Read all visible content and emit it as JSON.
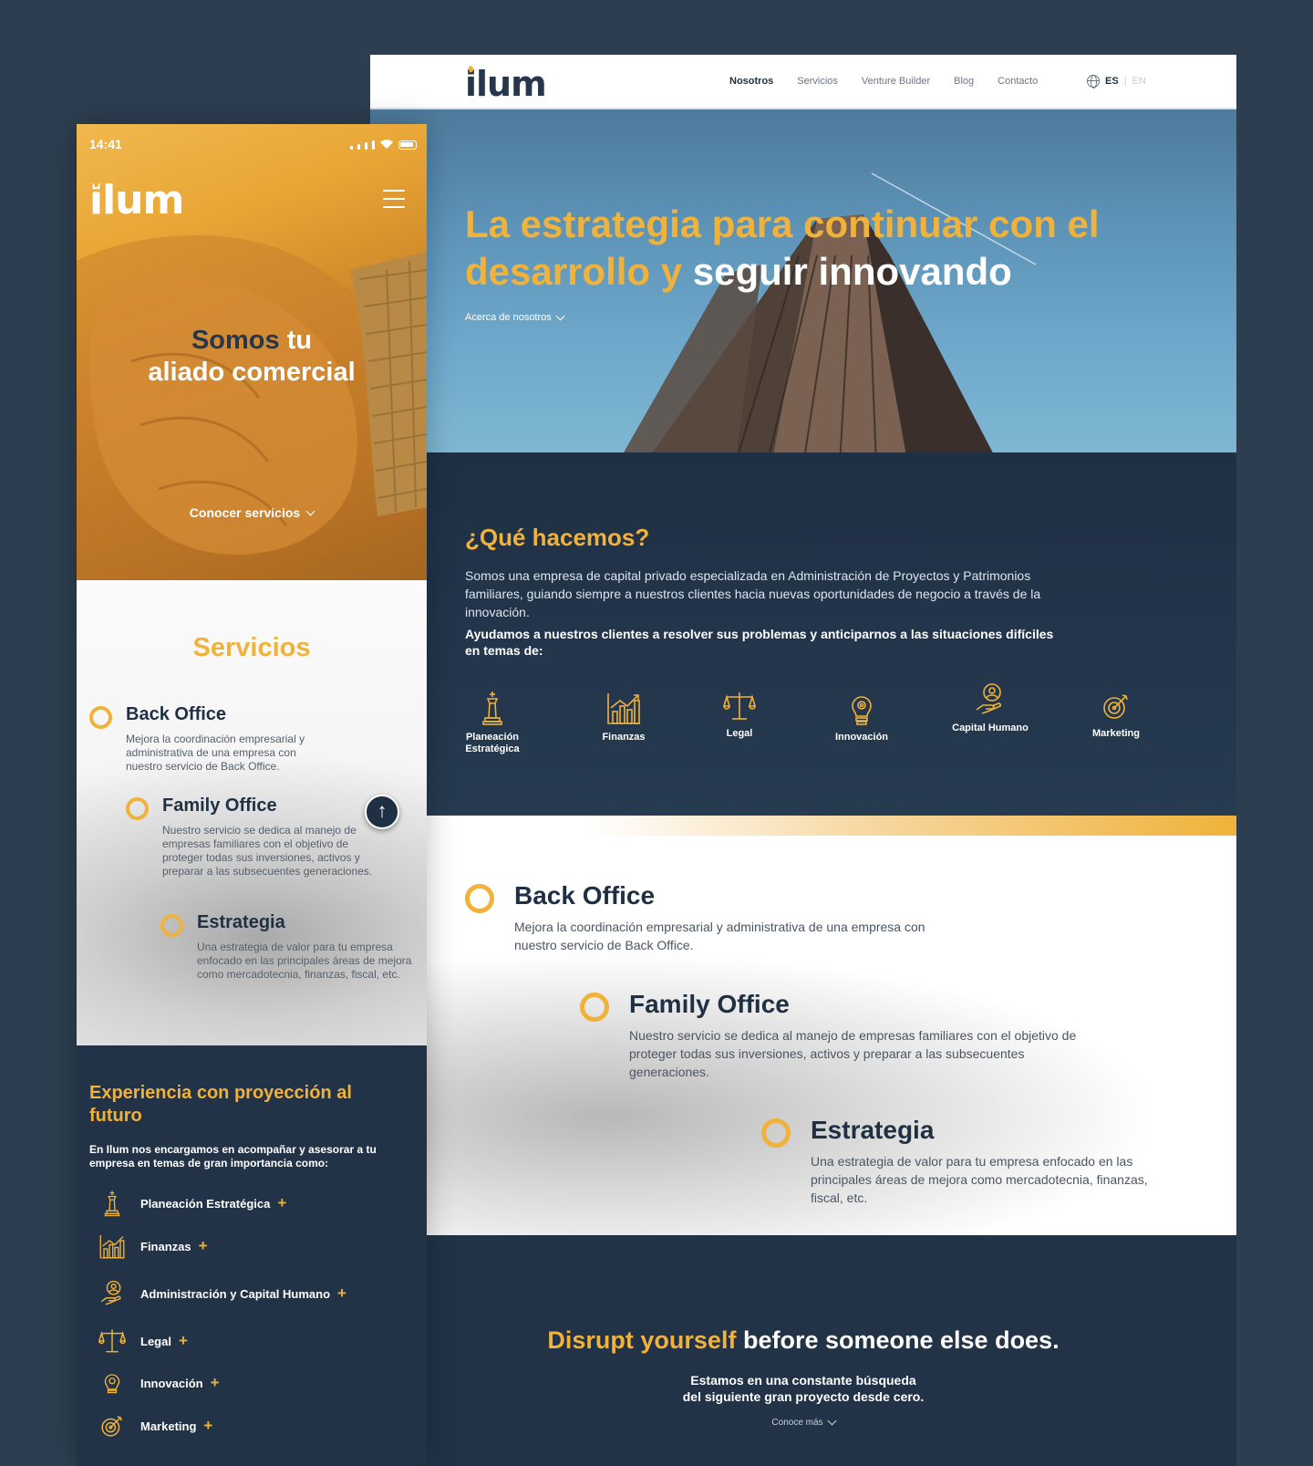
{
  "desktop": {
    "logo": "ilum",
    "nav": [
      "Nosotros",
      "Servicios",
      "Venture Builder",
      "Blog",
      "Contacto"
    ],
    "lang_active": "ES",
    "lang_other": "EN",
    "hero": {
      "title_yellow": "La estrategia para continuar con el desarrollo y",
      "title_white": "seguir innovando",
      "link": "Acerca de nosotros"
    },
    "what": {
      "title": "¿Qué hacemos?",
      "p1": "Somos una empresa de capital privado especializada en Administración de Proyectos y Patrimonios familiares, guiando siempre a nuestros clientes hacia nuevas oportunidades de negocio a través de la innovación.",
      "p2": "Ayudamos a nuestros clientes a resolver sus problemas y anticiparnos a las situaciones difíciles en temas de:",
      "icons": [
        {
          "icon": "chess-king-icon",
          "label": "Planeación Estratégica"
        },
        {
          "icon": "bar-chart-icon",
          "label": "Finanzas"
        },
        {
          "icon": "scale-icon",
          "label": "Legal"
        },
        {
          "icon": "lightbulb-gear-icon",
          "label": "Innovación"
        },
        {
          "icon": "person-hand-icon",
          "label": "Capital Humano"
        },
        {
          "icon": "target-icon",
          "label": "Marketing"
        }
      ]
    },
    "services": [
      {
        "title": "Back Office",
        "desc": "Mejora la coordinación empresarial y administrativa de una empresa con nuestro servicio de Back Office."
      },
      {
        "title": "Family Office",
        "desc": "Nuestro servicio se dedica al manejo de empresas familiares con el objetivo de proteger todas sus inversiones, activos y preparar a las subsecuentes generaciones."
      },
      {
        "title": "Estrategia",
        "desc": "Una estrategia de valor para tu empresa enfocado en las principales áreas de mejora como mercadotecnia, finanzas, fiscal, etc."
      }
    ],
    "disrupt": {
      "title_yellow": "Disrupt yourself",
      "title_white": "before someone else does.",
      "sub": "Estamos en una constante búsqueda del siguiente gran proyecto desde cero.",
      "link": "Conoce más"
    }
  },
  "mobile": {
    "time": "14:41",
    "logo": "ilum",
    "hero_dark": "Somos",
    "hero_white_1": "tu",
    "hero_white_2": "aliado comercial",
    "hero_link": "Conocer servicios",
    "services_title": "Servicios",
    "services": [
      {
        "title": "Back Office",
        "desc": "Mejora la coordinación empresarial y administrativa de una empresa con nuestro servicio de Back Office."
      },
      {
        "title": "Family Office",
        "desc": "Nuestro servicio se dedica al manejo de empresas familiares con el objetivo de proteger todas sus inversiones, activos y preparar a las subsecuentes generaciones."
      },
      {
        "title": "Estrategia",
        "desc": "Una estrategia de valor para tu empresa enfocado en las principales áreas de mejora como mercadotecnia, finanzas, fiscal, etc."
      }
    ],
    "exp": {
      "title": "Experiencia con proyección al futuro",
      "intro": "En Ilum nos encargamos en acompañar y asesorar a tu empresa en temas de gran importancia como:",
      "items": [
        {
          "icon": "chess-king-icon",
          "label": "Planeación Estratégica"
        },
        {
          "icon": "bar-chart-icon",
          "label": "Finanzas"
        },
        {
          "icon": "person-hand-icon",
          "label": "Administración y Capital Humano"
        },
        {
          "icon": "scale-icon",
          "label": "Legal"
        },
        {
          "icon": "lightbulb-gear-icon",
          "label": "Innovación"
        },
        {
          "icon": "target-icon",
          "label": "Marketing"
        }
      ]
    }
  },
  "colors": {
    "accent": "#f0b23a",
    "navy": "#223347",
    "text_dark": "#1f3044"
  }
}
